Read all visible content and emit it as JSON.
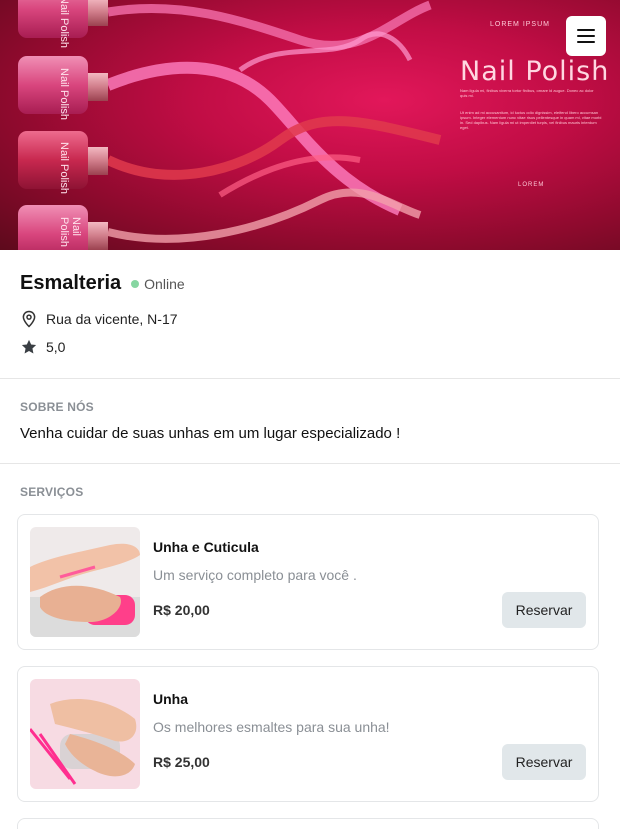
{
  "hero": {
    "brand_small": "LOREM IPSUM",
    "title": "Nail Polish",
    "small_text": "Nam ligula mi, finibus viverra tortor finibus, ornare id augue. Donec ac dolor quis mi.",
    "paragraph": "Ut enim ad mi accusantium, id luctus odio dignissim, eleifend libero accumsan ipsum. Integer elementum nunc vitae risus pellentesque in quam mi, vitae morbi in. Sed dapibus. Nam ligula mi ut imperdiet turpis, vel finibus mauris interdum eget.",
    "lorem": "LOREM",
    "bottle_label": "Nail Polish"
  },
  "store": {
    "name": "Esmalteria",
    "status": "Online",
    "address": "Rua da vicente, N-17",
    "rating": "5,0"
  },
  "about": {
    "label": "SOBRE NÓS",
    "text": "Venha cuidar de suas unhas em um lugar especializado !"
  },
  "services": {
    "label": "SERVIÇOS",
    "items": [
      {
        "title": "Unha e Cuticula",
        "description": "Um serviço completo para você .",
        "price": "R$ 20,00",
        "button": "Reservar"
      },
      {
        "title": "Unha",
        "description": "Os melhores esmaltes para sua unha!",
        "price": "R$ 25,00",
        "button": "Reservar"
      }
    ]
  },
  "icons": {
    "menu": "hamburger-menu-icon",
    "location": "map-pin-icon",
    "rating": "star-icon"
  },
  "colors": {
    "hero_primary": "#c10d45",
    "online_dot": "#86d6a1",
    "button_bg": "#e1e7ea",
    "muted_text": "#8a8f95"
  }
}
